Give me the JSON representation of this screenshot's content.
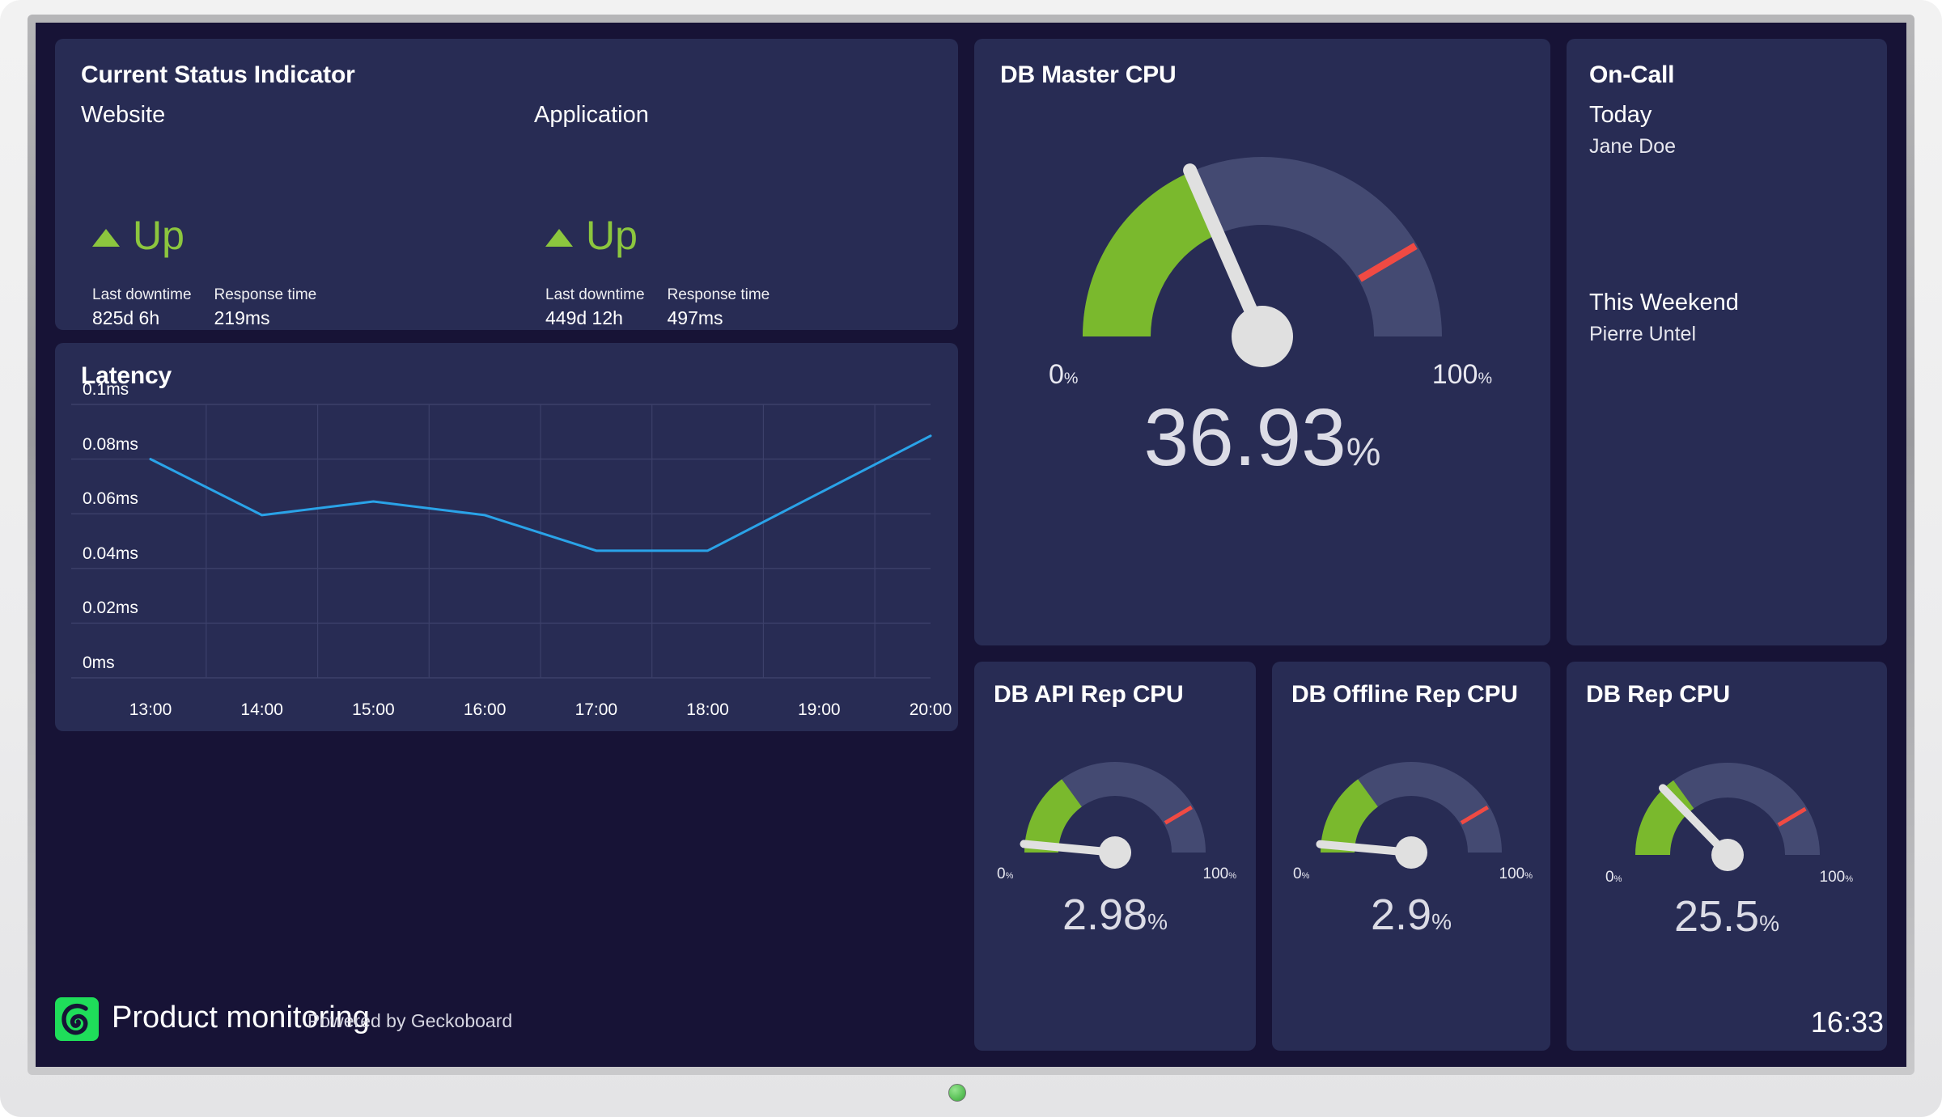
{
  "screen": {
    "background_color": "#171336",
    "panel_color": "#282c54"
  },
  "status_panel": {
    "title": "Current Status Indicator",
    "services": [
      {
        "name": "Website",
        "state": "Up",
        "state_color": "#8cc63e",
        "last_downtime_label": "Last downtime",
        "last_downtime_value": "825d 6h",
        "response_time_label": "Response time",
        "response_time_value": "219ms"
      },
      {
        "name": "Application",
        "state": "Up",
        "state_color": "#8cc63e",
        "last_downtime_label": "Last downtime",
        "last_downtime_value": "449d 12h",
        "response_time_label": "Response time",
        "response_time_value": "497ms"
      }
    ]
  },
  "latency_panel": {
    "title": "Latency"
  },
  "chart_data": {
    "type": "line",
    "title": "Latency",
    "xlabel": "",
    "ylabel": "",
    "grid": true,
    "legend": "none",
    "line_color": "#2aa3e8",
    "x": [
      "13:00",
      "14:00",
      "15:00",
      "16:00",
      "17:00",
      "18:00",
      "19:00",
      "20:00"
    ],
    "ytick_labels": [
      "0.1ms",
      "0.08ms",
      "0.06ms",
      "0.04ms",
      "0.02ms",
      "0ms"
    ],
    "ytick_values": [
      0.1,
      0.08,
      0.06,
      0.04,
      0.02,
      0
    ],
    "ylim": [
      0,
      0.1
    ],
    "unit": "ms",
    "series": [
      {
        "name": "Latency",
        "values": [
          0.08,
          0.0595,
          0.0645,
          0.0595,
          0.0465,
          0.0465,
          0.0675,
          0.0885
        ]
      }
    ]
  },
  "db_master_panel": {
    "title": "DB Master CPU",
    "gauge": {
      "value": 36.93,
      "value_text": "36.93",
      "unit": "%",
      "min_label": "0",
      "max_label": "100",
      "min": 0,
      "max": 100,
      "green_zone_end": 37,
      "red_marker_at": 83,
      "green_color": "#7ab92d",
      "track_color": "#444a72",
      "needle_color": "#e0e0e0",
      "marker_color": "#f04a43"
    }
  },
  "oncall_panel": {
    "title": "On-Call",
    "entries": [
      {
        "when": "Today",
        "who": "Jane Doe"
      },
      {
        "when": "This Weekend",
        "who": "Pierre Untel"
      }
    ]
  },
  "small_gauges": [
    {
      "title": "DB API Rep CPU",
      "value": 2.98,
      "value_text": "2.98",
      "unit": "%",
      "min_label": "0",
      "max_label": "100",
      "min": 0,
      "max": 100,
      "green_zone_end": 30,
      "red_marker_at": 83
    },
    {
      "title": "DB Offline Rep CPU",
      "value": 2.9,
      "value_text": "2.9",
      "unit": "%",
      "min_label": "0",
      "max_label": "100",
      "min": 0,
      "max": 100,
      "green_zone_end": 30,
      "red_marker_at": 83
    },
    {
      "title": "DB Rep CPU",
      "value": 25.5,
      "value_text": "25.5",
      "unit": "%",
      "min_label": "0",
      "max_label": "100",
      "min": 0,
      "max": 100,
      "green_zone_end": 30,
      "red_marker_at": 83
    }
  ],
  "footer": {
    "title": "Product monitoring",
    "subtitle": "Powered by Geckoboard",
    "clock": "16:33",
    "logo_color": "#1fdd5a"
  }
}
